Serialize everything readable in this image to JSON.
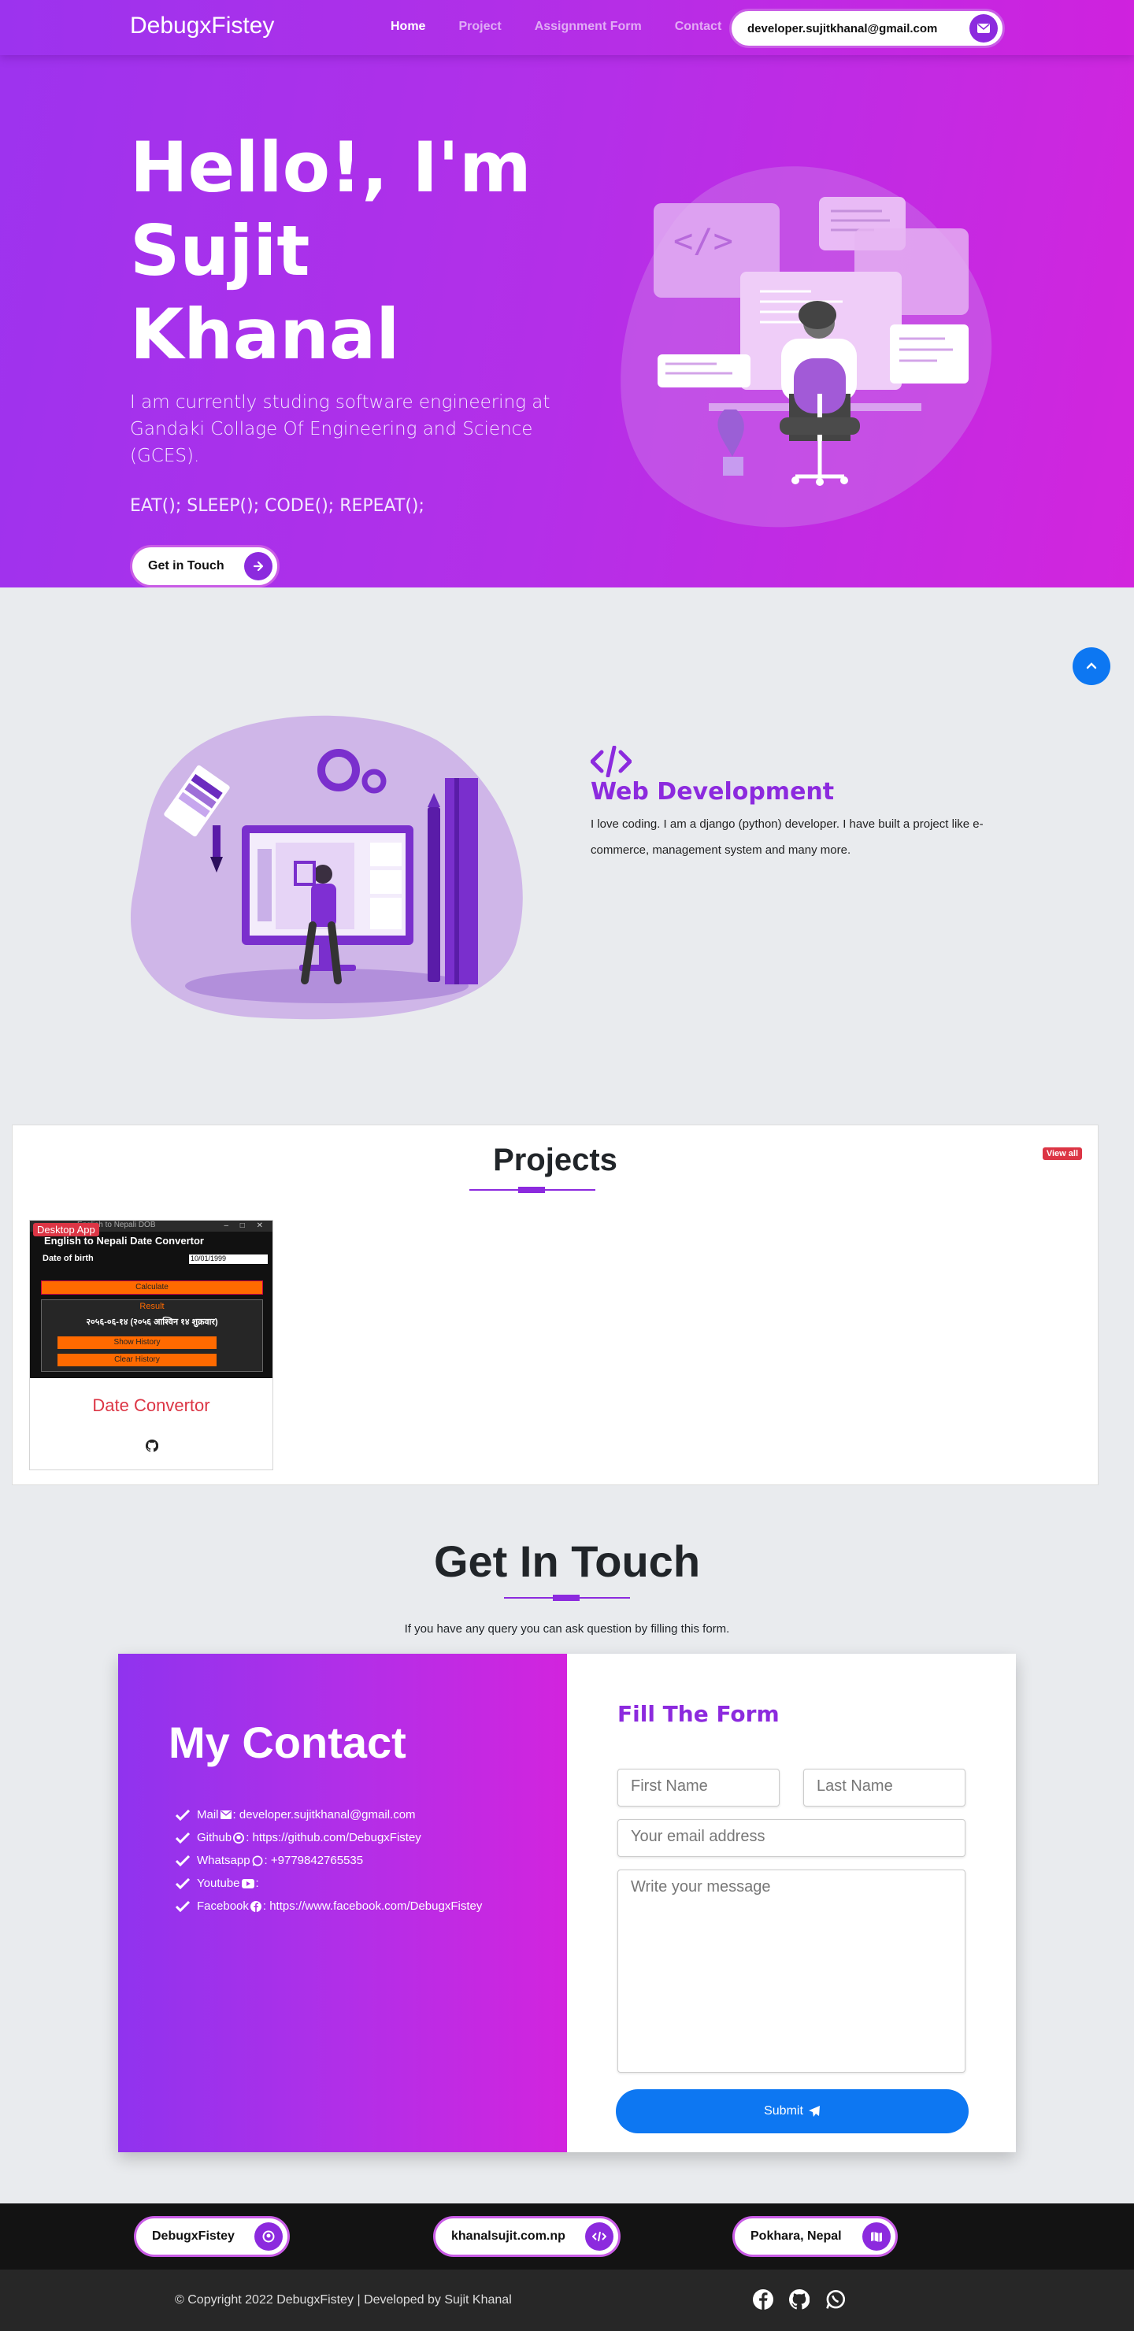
{
  "nav": {
    "brand": "DebugxFistey",
    "links": [
      {
        "label": "Home",
        "active": true
      },
      {
        "label": "Project",
        "active": false
      },
      {
        "label": "Assignment Form",
        "active": false
      },
      {
        "label": "Contact",
        "active": false
      }
    ],
    "email": "developer.sujitkhanal@gmail.com"
  },
  "hero": {
    "title": "Hello!, I'm Sujit Khanal",
    "description": "I am currently studing software engineering at Gandaki Collage Of Engineering and Science (GCES).",
    "motto": "EAT(); SLEEP(); CODE(); REPEAT();",
    "button": "Get in Touch"
  },
  "webdev": {
    "title": "Web Development",
    "text": "I love coding. I am a django (python) developer. I have built a project like e-commerce, management system and many more."
  },
  "projects": {
    "title": "Projects",
    "view_all": "View all",
    "cards": [
      {
        "badge": "Desktop App",
        "title": "Date Convertor",
        "app": {
          "window_title": "English to Nepali DOB",
          "heading": "English to Nepali Date Convertor",
          "dob_label": "Date of birth",
          "dob_value": "10/01/1999",
          "calculate": "Calculate",
          "result_label": "Result",
          "result_value": "२०५६-०६-१४ (२०५६ आश्विन १४ शुक्रवार)",
          "show_history": "Show History",
          "clear_history": "Clear History"
        }
      }
    ]
  },
  "contact": {
    "title": "Get In Touch",
    "subtitle": "If you have any query you can ask question by filling this form.",
    "my_contact": "My Contact",
    "items": [
      {
        "label": "Mail",
        "icon": "envelope-icon",
        "value": ": developer.sujitkhanal@gmail.com"
      },
      {
        "label": "Github",
        "icon": "github-icon",
        "value": ": https://github.com/DebugxFistey"
      },
      {
        "label": "Whatsapp",
        "icon": "whatsapp-icon",
        "value": ": +9779842765535"
      },
      {
        "label": "Youtube",
        "icon": "youtube-icon",
        "value": ":"
      },
      {
        "label": "Facebook",
        "icon": "facebook-icon",
        "value": ": https://www.facebook.com/DebugxFistey"
      }
    ],
    "form": {
      "title": "Fill The Form",
      "first_name": "First Name",
      "last_name": "Last Name",
      "email": "Your email address",
      "message": "Write your message",
      "submit": "Submit"
    }
  },
  "footer": {
    "pills": [
      {
        "label": "DebugxFistey",
        "icon": "github-icon"
      },
      {
        "label": "khanalsujit.com.np",
        "icon": "code-icon"
      },
      {
        "label": "Pokhara, Nepal",
        "icon": "map-icon"
      }
    ],
    "copyright": "© Copyright 2022 DebugxFistey | Developed by Sujit Khanal",
    "socials": [
      "facebook-icon",
      "github-icon",
      "whatsapp-icon"
    ]
  },
  "colors": {
    "purple": "#8c2ade",
    "blue": "#0d77f2",
    "red": "#dc3545",
    "hero_start": "#9d33ee",
    "hero_end": "#d225dd"
  }
}
